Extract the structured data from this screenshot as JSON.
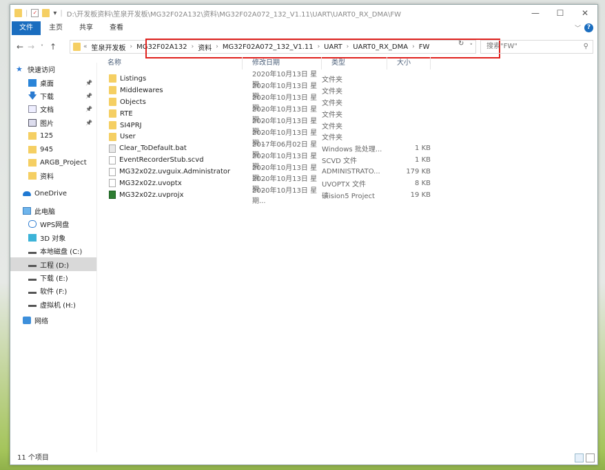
{
  "title": "D:\\开发板资料\\笙泉开发板\\MG32F02A132\\资料\\MG32F02A072_132_V1.11\\UART\\UART0_RX_DMA\\FW",
  "window_controls": {
    "minimize": "—",
    "maximize": "☐",
    "close": "✕"
  },
  "ribbon_tabs": [
    "文件",
    "主页",
    "共享",
    "查看"
  ],
  "help": "?",
  "breadcrumbs": [
    "笙泉开发板",
    "MG32F02A132",
    "资料",
    "MG32F02A072_132_V1.11",
    "UART",
    "UART0_RX_DMA",
    "FW"
  ],
  "search_placeholder": "搜索\"FW\"",
  "sidebar": {
    "quick_access": "快速访问",
    "items": [
      {
        "label": "桌面",
        "icon": "desktop-icon",
        "pinned": true
      },
      {
        "label": "下载",
        "icon": "download-icon",
        "pinned": true
      },
      {
        "label": "文档",
        "icon": "document-icon",
        "pinned": true
      },
      {
        "label": "图片",
        "icon": "pictures-icon",
        "pinned": true
      },
      {
        "label": "125",
        "icon": "folder-icon"
      },
      {
        "label": "945",
        "icon": "folder-icon"
      },
      {
        "label": "ARGB_Project",
        "icon": "folder-icon"
      },
      {
        "label": "资料",
        "icon": "folder-icon"
      }
    ],
    "onedrive": "OneDrive",
    "this_pc": "此电脑",
    "pc_items": [
      {
        "label": "WPS网盘",
        "icon": "cloud-icon"
      },
      {
        "label": "3D 对象",
        "icon": "3d-objects-icon"
      },
      {
        "label": "本地磁盘 (C:)",
        "icon": "drive-icon"
      },
      {
        "label": "工程 (D:)",
        "icon": "drive-icon",
        "selected": true
      },
      {
        "label": "下载 (E:)",
        "icon": "drive-icon"
      },
      {
        "label": "软件 (F:)",
        "icon": "drive-icon"
      },
      {
        "label": "虚拟机 (H:)",
        "icon": "drive-icon"
      }
    ],
    "network": "网络"
  },
  "columns": [
    "名称",
    "修改日期",
    "类型",
    "大小"
  ],
  "files": [
    {
      "name": "Listings",
      "date": "2020年10月13日 星期...",
      "type": "文件夹",
      "size": "",
      "icon": "folder"
    },
    {
      "name": "Middlewares",
      "date": "2020年10月13日 星期...",
      "type": "文件夹",
      "size": "",
      "icon": "folder"
    },
    {
      "name": "Objects",
      "date": "2020年10月13日 星期...",
      "type": "文件夹",
      "size": "",
      "icon": "folder"
    },
    {
      "name": "RTE",
      "date": "2020年10月13日 星期...",
      "type": "文件夹",
      "size": "",
      "icon": "folder"
    },
    {
      "name": "SI4PRJ",
      "date": "2020年10月13日 星期...",
      "type": "文件夹",
      "size": "",
      "icon": "folder"
    },
    {
      "name": "User",
      "date": "2020年10月13日 星期...",
      "type": "文件夹",
      "size": "",
      "icon": "folder"
    },
    {
      "name": "Clear_ToDefault.bat",
      "date": "2017年06月02日 星期...",
      "type": "Windows 批处理...",
      "size": "1 KB",
      "icon": "bat"
    },
    {
      "name": "EventRecorderStub.scvd",
      "date": "2020年10月13日 星期...",
      "type": "SCVD 文件",
      "size": "1 KB",
      "icon": "file"
    },
    {
      "name": "MG32x02z.uvguix.Administrator",
      "date": "2020年10月13日 星期...",
      "type": "ADMINISTRATO...",
      "size": "179 KB",
      "icon": "file"
    },
    {
      "name": "MG32x02z.uvoptx",
      "date": "2020年10月13日 星期...",
      "type": "UVOPTX 文件",
      "size": "8 KB",
      "icon": "file"
    },
    {
      "name": "MG32x02z.uvprojx",
      "date": "2020年10月13日 星期...",
      "type": "礦ision5 Project",
      "size": "19 KB",
      "icon": "keil"
    }
  ],
  "status": "11 个项目"
}
